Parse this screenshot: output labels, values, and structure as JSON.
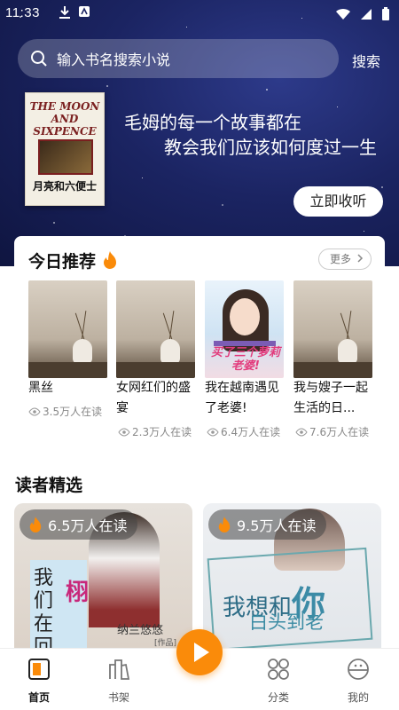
{
  "status_bar": {
    "time": "11:33"
  },
  "search": {
    "placeholder": "输入书名搜索小说",
    "button": "搜索"
  },
  "banner": {
    "book_title_en": "THE MOON AND SIXPENCE",
    "book_title_cn": "月亮和六便士",
    "quote_line1": "毛姆的每一个故事都在",
    "quote_line2": "教会我们应该如何度过一生",
    "listen_button": "立即收听"
  },
  "today": {
    "title": "今日推荐",
    "more_label": "更多",
    "books": [
      {
        "title": "黑丝",
        "readers": "3.5万人在读"
      },
      {
        "title": "女网红们的盛宴",
        "readers": "2.3万人在读"
      },
      {
        "title": "我在越南遇见了老婆!",
        "readers": "6.4万人在读",
        "cover_text": "买了三个萝莉老婆!"
      },
      {
        "title": "我与嫂子一起生活的日...",
        "readers": "7.6万人在读"
      }
    ]
  },
  "readers": {
    "title": "读者精选",
    "cards": [
      {
        "readers": "6.5万人在读",
        "cover_title": "我们在回",
        "cover_title_accent": "栩",
        "cover_author": "纳兰悠悠",
        "cover_role": "[作品]"
      },
      {
        "readers": "9.5万人在读",
        "cover_title_pre": "我想和",
        "cover_title_big": "你",
        "cover_subtitle": "白头到老"
      }
    ]
  },
  "tabbar": {
    "items": [
      {
        "label": "首页",
        "icon": "home-book-icon",
        "active": true
      },
      {
        "label": "书架",
        "icon": "bookshelf-icon",
        "active": false
      },
      {
        "label": "",
        "icon": "play-icon",
        "active": false
      },
      {
        "label": "分类",
        "icon": "category-grid-icon",
        "active": false
      },
      {
        "label": "我的",
        "icon": "profile-icon",
        "active": false
      }
    ]
  },
  "colors": {
    "accent": "#fa8b0a",
    "hero_bg": "#1b2462",
    "flame": "#fa8b0a"
  }
}
